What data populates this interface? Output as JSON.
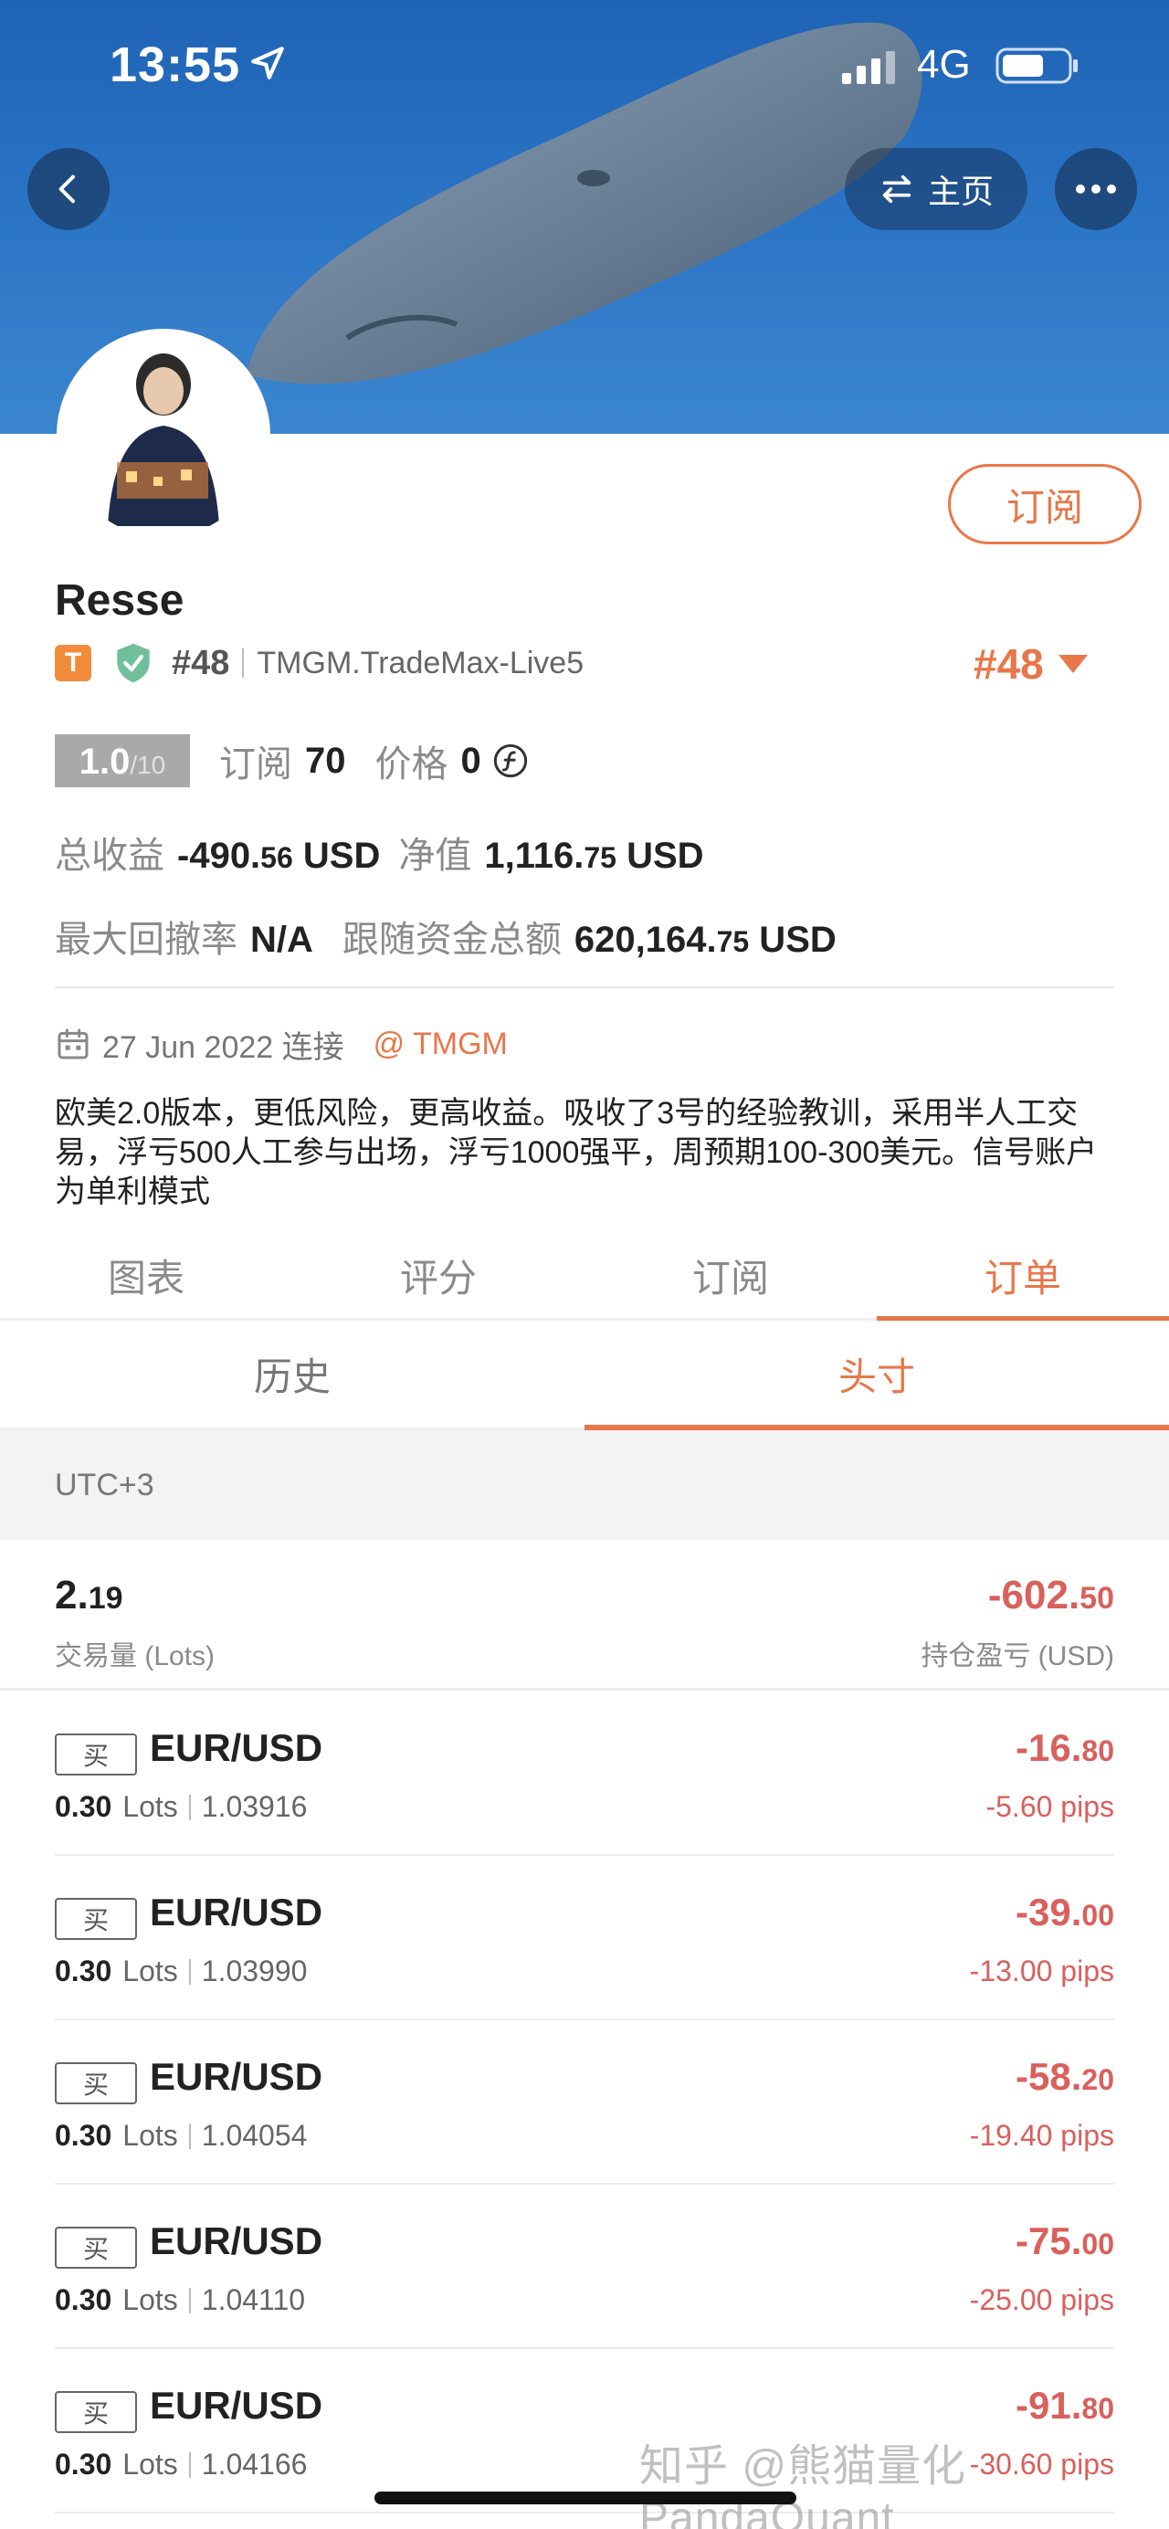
{
  "status_bar": {
    "time": "13:55",
    "network": "4G"
  },
  "nav": {
    "home_label": "主页"
  },
  "profile": {
    "subscribe_label": "订阅",
    "name": "Resse",
    "tier_badge": "T",
    "rank": "#48",
    "account": "TMGM.TradeMax-Live5",
    "rank_big": "#48",
    "score": "1.0",
    "score_max": "/10",
    "subs_label": "订阅",
    "subs_value": "70",
    "price_label": "价格",
    "price_value": "0",
    "total_profit_label": "总收益",
    "total_profit_int": "-490.",
    "total_profit_dec": "56",
    "total_profit_unit": " USD",
    "equity_label": "净值",
    "equity_int": "1,116.",
    "equity_dec": "75",
    "equity_unit": " USD",
    "max_dd_label": "最大回撤率",
    "max_dd_value": "N/A",
    "follow_label": "跟随资金总额",
    "follow_int": "620,164.",
    "follow_dec": "75",
    "follow_unit": " USD",
    "join_date": "27 Jun 2022 连接",
    "broker": "@ TMGM",
    "description": "欧美2.0版本，更低风险，更高收益。吸收了3号的经验教训，采用半人工交易，浮亏500人工参与出场，浮亏1000强平，周预期100-300美元。信号账户为单利模式"
  },
  "tabs": [
    {
      "label": "图表"
    },
    {
      "label": "评分"
    },
    {
      "label": "订阅"
    },
    {
      "label": "订单"
    }
  ],
  "sub_tabs": [
    {
      "label": "历史"
    },
    {
      "label": "头寸"
    }
  ],
  "timezone": "UTC+3",
  "summary": {
    "lots_int": "2.",
    "lots_dec": "19",
    "lots_label": "交易量 (Lots)",
    "pl_int": "-602.",
    "pl_dec": "50",
    "pl_label": "持仓盈亏 (USD)"
  },
  "positions": [
    {
      "side": "买",
      "symbol": "EUR/USD",
      "lots": "0.30",
      "lots_unit": "Lots",
      "price": "1.03916",
      "pnl_int": "-16.",
      "pnl_dec": "80",
      "pips": "-5.60 pips"
    },
    {
      "side": "买",
      "symbol": "EUR/USD",
      "lots": "0.30",
      "lots_unit": "Lots",
      "price": "1.03990",
      "pnl_int": "-39.",
      "pnl_dec": "00",
      "pips": "-13.00 pips"
    },
    {
      "side": "买",
      "symbol": "EUR/USD",
      "lots": "0.30",
      "lots_unit": "Lots",
      "price": "1.04054",
      "pnl_int": "-58.",
      "pnl_dec": "20",
      "pips": "-19.40 pips"
    },
    {
      "side": "买",
      "symbol": "EUR/USD",
      "lots": "0.30",
      "lots_unit": "Lots",
      "price": "1.04110",
      "pnl_int": "-75.",
      "pnl_dec": "00",
      "pips": "-25.00 pips"
    },
    {
      "side": "买",
      "symbol": "EUR/USD",
      "lots": "0.30",
      "lots_unit": "Lots",
      "price": "1.04166",
      "pnl_int": "-91.",
      "pnl_dec": "80",
      "pips": "-30.60 pips"
    }
  ],
  "watermark": "知乎 @熊猫量化 PandaQuant",
  "colors": {
    "accent": "#e8774a",
    "loss": "#d9605c",
    "banner": "#2a73c4"
  }
}
